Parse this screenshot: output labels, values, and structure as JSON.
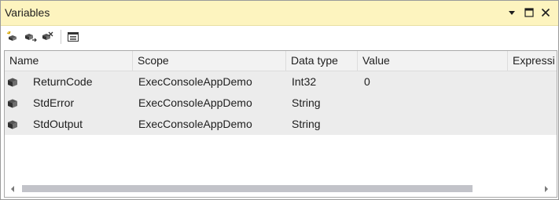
{
  "panel": {
    "title": "Variables",
    "buttons": {
      "dropdown_icon": "chevron-down-icon",
      "maximize_icon": "maximize-icon",
      "close_icon": "close-icon"
    }
  },
  "toolbar": {
    "tools": [
      {
        "name": "add-variable-button",
        "icon": "add-variable-icon"
      },
      {
        "name": "move-variable-button",
        "icon": "move-variable-icon"
      },
      {
        "name": "delete-variable-button",
        "icon": "delete-variable-icon"
      },
      {
        "name": "grid-options-button",
        "icon": "grid-options-icon"
      }
    ]
  },
  "grid": {
    "columns": [
      "Name",
      "Scope",
      "Data type",
      "Value",
      "Expressi"
    ],
    "rows": [
      {
        "icon": "variable-icon",
        "name": "ReturnCode",
        "scope": "ExecConsoleAppDemo",
        "data_type": "Int32",
        "value": "0"
      },
      {
        "icon": "variable-icon",
        "name": "StdError",
        "scope": "ExecConsoleAppDemo",
        "data_type": "String",
        "value": ""
      },
      {
        "icon": "variable-icon",
        "name": "StdOutput",
        "scope": "ExecConsoleAppDemo",
        "data_type": "String",
        "value": ""
      }
    ]
  },
  "colors": {
    "title_bar": "#fdf4bf",
    "row_background": "#ececec",
    "header_background": "#f2f2f2",
    "scroll_thumb": "#c2c3c9"
  }
}
